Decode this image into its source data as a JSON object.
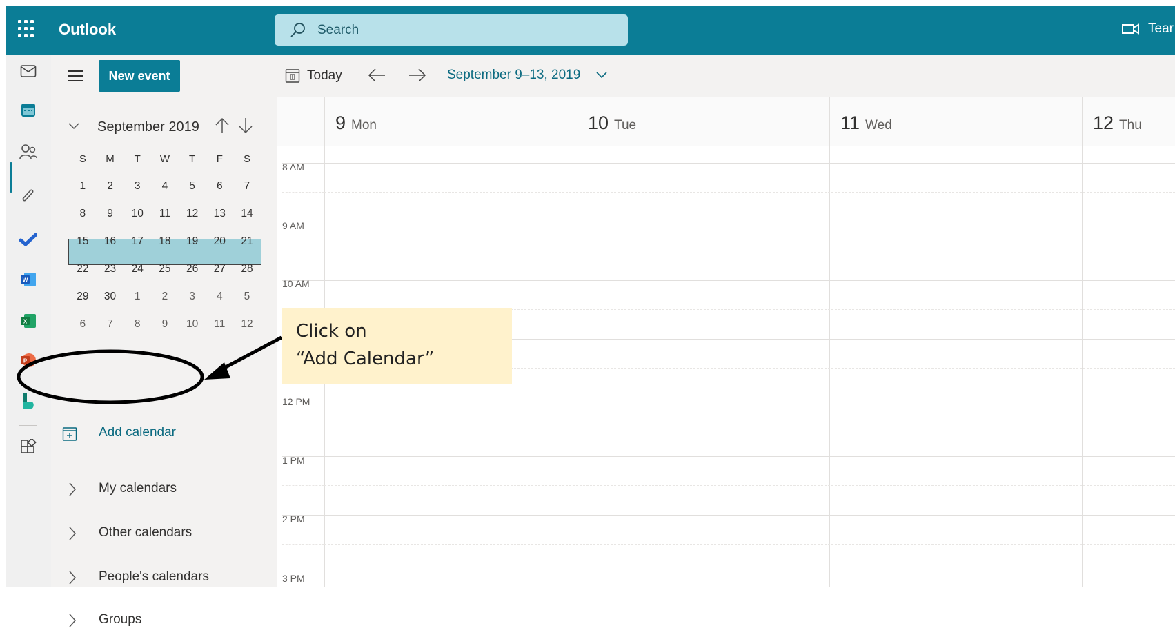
{
  "app": {
    "title": "Outlook"
  },
  "search": {
    "placeholder": "Search"
  },
  "header": {
    "teams_label": "Tear"
  },
  "toolbar": {
    "new_event_label": "New event"
  },
  "mini_calendar": {
    "month_label": "September 2019",
    "weekdays": [
      "S",
      "M",
      "T",
      "W",
      "T",
      "F",
      "S"
    ],
    "weeks": [
      [
        "1",
        "2",
        "3",
        "4",
        "5",
        "6",
        "7"
      ],
      [
        "8",
        "9",
        "10",
        "11",
        "12",
        "13",
        "14"
      ],
      [
        "15",
        "16",
        "17",
        "18",
        "19",
        "20",
        "21"
      ],
      [
        "22",
        "23",
        "24",
        "25",
        "26",
        "27",
        "28"
      ],
      [
        "29",
        "30",
        "1",
        "2",
        "3",
        "4",
        "5"
      ],
      [
        "6",
        "7",
        "8",
        "9",
        "10",
        "11",
        "12"
      ]
    ],
    "selected_week_index": 1
  },
  "sidebar": {
    "add_calendar_label": "Add calendar",
    "groups": [
      "My calendars",
      "Other calendars",
      "People's calendars",
      "Groups"
    ]
  },
  "command_bar": {
    "today_label": "Today",
    "date_range_label": "September 9–13, 2019"
  },
  "days": [
    {
      "num": "9",
      "name": "Mon"
    },
    {
      "num": "10",
      "name": "Tue"
    },
    {
      "num": "11",
      "name": "Wed"
    },
    {
      "num": "12",
      "name": "Thu"
    }
  ],
  "time_labels": [
    "8 AM",
    "9 AM",
    "10 AM",
    "12 PM",
    "1 PM",
    "2 PM",
    "3 PM"
  ],
  "callout": {
    "line1": "Click on",
    "line2": "“Add Calendar”"
  },
  "colors": {
    "accent": "#0b7d96",
    "week_highlight": "#9fd0d9",
    "callout_bg": "#fff2cc"
  },
  "rail_icons": [
    "mail-icon",
    "calendar-icon",
    "people-icon",
    "attachment-icon",
    "todo-icon",
    "word-icon",
    "excel-icon",
    "powerpoint-icon",
    "bookings-icon",
    "apps-icon"
  ]
}
